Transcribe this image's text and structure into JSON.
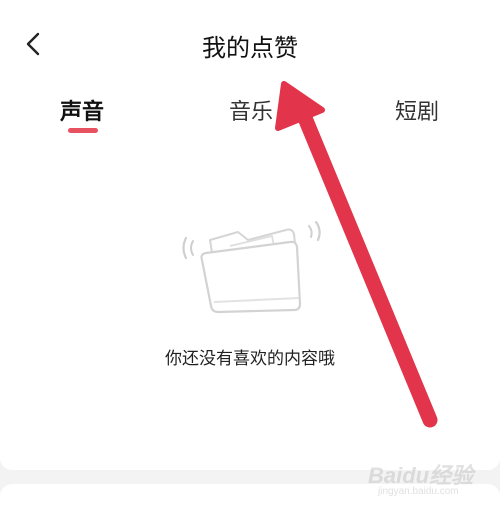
{
  "header": {
    "title": "我的点赞"
  },
  "tabs": [
    {
      "label": "声音",
      "active": true
    },
    {
      "label": "音乐",
      "active": false
    },
    {
      "label": "短剧",
      "active": false
    }
  ],
  "empty_state": {
    "message": "你还没有喜欢的内容哦",
    "icon": "empty-folder-icon"
  },
  "icons": {
    "back": "chevron-left-icon"
  },
  "colors": {
    "accent": "#e8515f",
    "annotation_arrow": "#e2344a",
    "background": "#f3f3f4"
  },
  "watermark": {
    "main": "Baidu经验",
    "sub": "jingyan.baidu.com"
  }
}
